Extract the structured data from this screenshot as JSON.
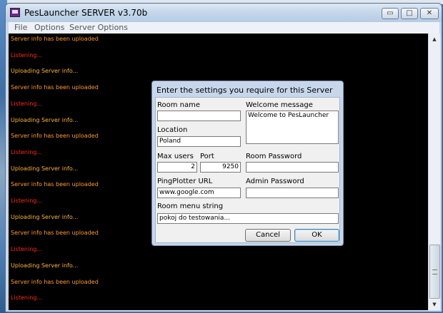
{
  "window": {
    "title": "PesLauncher SERVER v3.70b",
    "minimize_glyph": "▭",
    "maximize_glyph": "□",
    "close_glyph": "✕"
  },
  "menu": [
    "File",
    "Options",
    "Server Options"
  ],
  "log": [
    {
      "text": "Server info has been uploaded",
      "color": "#ff9a2e"
    },
    {
      "text": "Listening...",
      "color": "#ff2a1a"
    },
    {
      "text": "Uploading Server info...",
      "color": "#ffb43c"
    },
    {
      "text": "Server info has been uploaded",
      "color": "#ff9a2e"
    },
    {
      "text": "Listening...",
      "color": "#ff2a1a"
    },
    {
      "text": "Uploading Server info...",
      "color": "#ffb43c"
    },
    {
      "text": "Server info has been uploaded",
      "color": "#ff9a2e"
    },
    {
      "text": "Listening...",
      "color": "#ff2a1a"
    },
    {
      "text": "Uploading Server info...",
      "color": "#ffb43c"
    },
    {
      "text": "Server info has been uploaded",
      "color": "#ff9a2e"
    },
    {
      "text": "Listening...",
      "color": "#ff2a1a"
    },
    {
      "text": "Uploading Server info...",
      "color": "#ffb43c"
    },
    {
      "text": "Server info has been uploaded",
      "color": "#ff9a2e"
    },
    {
      "text": "Listening...",
      "color": "#ff2a1a"
    },
    {
      "text": "Uploading Server info...",
      "color": "#ffb43c"
    },
    {
      "text": "Server info has been uploaded",
      "color": "#ff9a2e"
    },
    {
      "text": "Listening...",
      "color": "#ff2a1a"
    }
  ],
  "scrollbar": {
    "up_glyph": "▲",
    "down_glyph": "▼"
  },
  "dialog": {
    "title": "Enter the settings you require for this Server",
    "room_name": {
      "label": "Room name",
      "value": ""
    },
    "welcome": {
      "label": "Welcome message",
      "value": "Welcome to PesLauncher"
    },
    "location": {
      "label": "Location",
      "value": "Poland"
    },
    "max_users": {
      "label": "Max users",
      "value": "2"
    },
    "port": {
      "label": "Port",
      "value": "9250"
    },
    "room_password": {
      "label": "Room Password",
      "value": ""
    },
    "pingplotter": {
      "label": "PingPlotter URL",
      "value": "www.google.com"
    },
    "admin_password": {
      "label": "Admin Password",
      "value": ""
    },
    "room_menu": {
      "label": "Room menu string",
      "value": "pokoj do testowania..."
    },
    "cancel_label": "Cancel",
    "ok_label": "OK"
  }
}
